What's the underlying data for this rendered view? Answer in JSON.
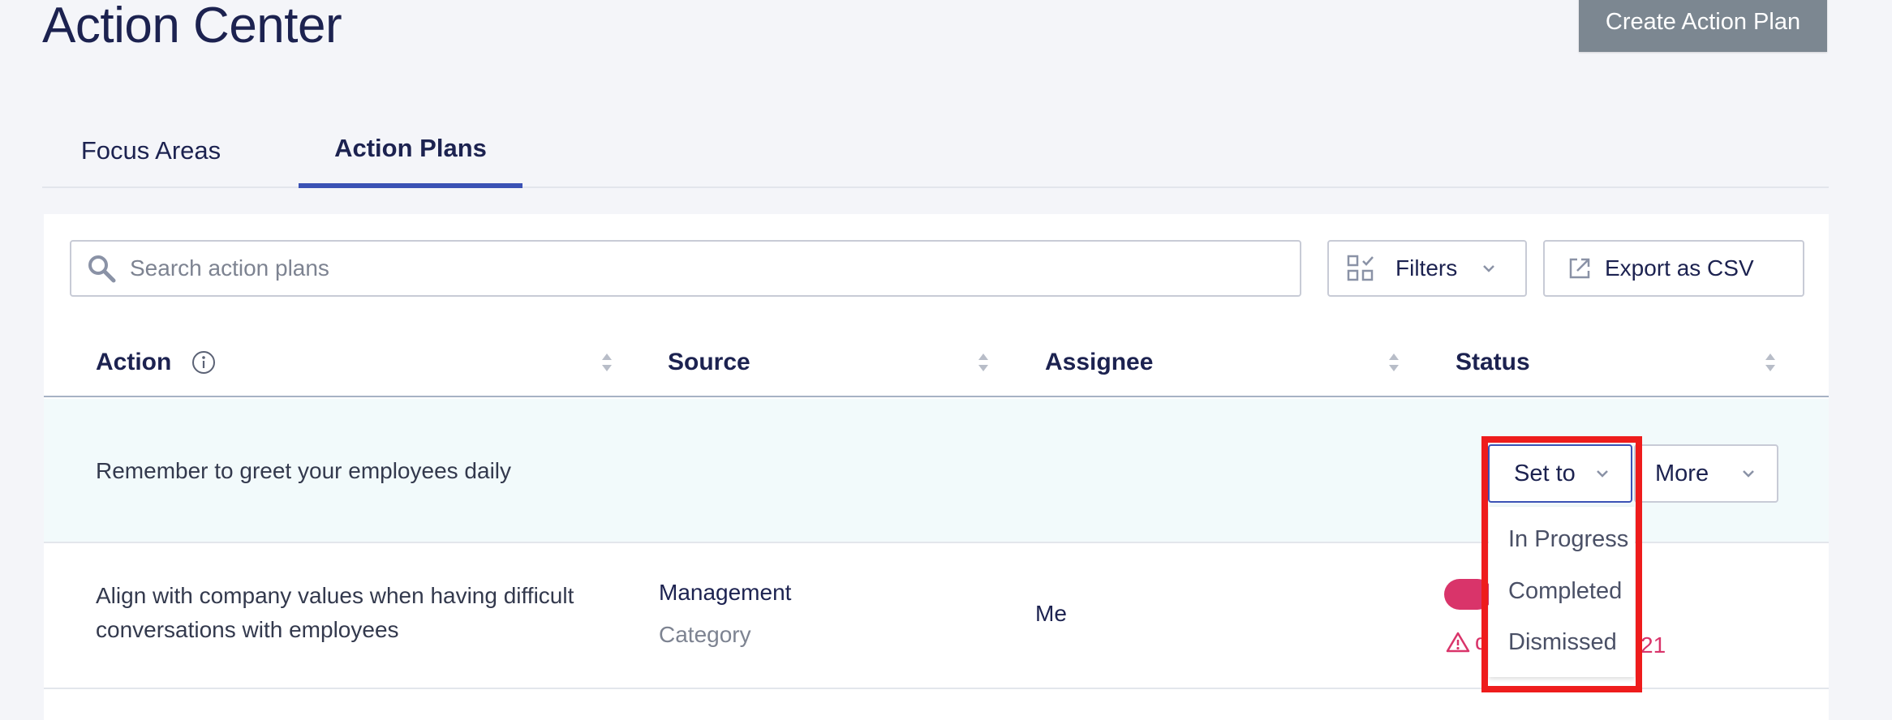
{
  "header": {
    "title": "Action Center",
    "create_button": "Create Action Plan"
  },
  "tabs": [
    {
      "label": "Focus Areas",
      "active": false
    },
    {
      "label": "Action Plans",
      "active": true
    }
  ],
  "toolbar": {
    "search_placeholder": "Search action plans",
    "filters_label": "Filters",
    "export_label": "Export as CSV"
  },
  "table": {
    "columns": [
      "Action",
      "Source",
      "Assignee",
      "Status"
    ],
    "rows": [
      {
        "action": "Remember to greet your employees daily",
        "set_to_label": "Set to",
        "more_label": "More"
      },
      {
        "action_line1": "Align with company values when having difficult",
        "action_line2": "conversations with employees",
        "source": "Management",
        "source_type": "Category",
        "assignee": "Me",
        "due_partial": "d",
        "due_tail": "21"
      }
    ]
  },
  "status_menu": {
    "options": [
      "In Progress",
      "Completed",
      "Dismissed"
    ]
  },
  "colors": {
    "accent": "#3b52b5",
    "title": "#1c2250",
    "create_button_bg": "#7c8791",
    "overdue": "#d9346a",
    "highlight": "#ee1c1c",
    "row_hover": "#f2fafb"
  }
}
